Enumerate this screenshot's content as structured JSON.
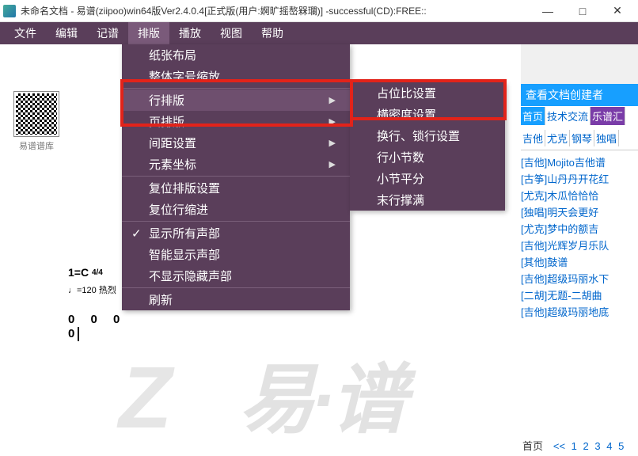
{
  "title": "未命名文档 - 易谱(ziipoo)win64版Ver2.4.0.4[正式版(用户:婀旷摇嶅槑瓓)] -successful(CD):FREE::",
  "menu": {
    "items": [
      "文件",
      "编辑",
      "记谱",
      "排版",
      "播放",
      "视图",
      "帮助"
    ],
    "active": 3
  },
  "dropdown": {
    "g1": [
      "纸张布局",
      "整体字号缩放"
    ],
    "g2": [
      {
        "label": "行排版",
        "arrow": true,
        "hover": true
      },
      {
        "label": "页排版",
        "arrow": true
      },
      {
        "label": "间距设置",
        "arrow": true
      },
      {
        "label": "元素坐标",
        "arrow": true
      }
    ],
    "g3": [
      "复位排版设置",
      "复位行缩进"
    ],
    "g4": [
      {
        "label": "显示所有声部",
        "check": true
      },
      {
        "label": "智能显示声部"
      },
      {
        "label": "不显示隐藏声部"
      }
    ],
    "g5": [
      "刷新"
    ]
  },
  "submenu": [
    "占位比设置",
    "横密度设置",
    "换行、锁行设置",
    "行小节数",
    "小节平分",
    "末行撑满"
  ],
  "qr_label": "易谱谱库",
  "score": {
    "key": "1=C",
    "time": "4/4",
    "tempo": "♩=120 热烈",
    "notes": "0 0 0 0"
  },
  "sidebar": {
    "view_author": "查看文档创建者",
    "tabs": [
      "首页",
      "技术交流",
      "乐谱汇"
    ],
    "cats": [
      "吉他",
      "尤克",
      "钢琴",
      "独唱"
    ],
    "songs": [
      "[吉他]Mojito吉他谱",
      "[古筝]山丹丹开花红",
      "[尤克]木瓜恰恰恰",
      "[独唱]明天会更好",
      "[尤克]梦中的额吉",
      "[吉他]光辉岁月乐队",
      "[其他]鼓谱",
      "[吉他]超级玛丽水下",
      "[二胡]无题-二胡曲",
      "[吉他]超级玛丽地底"
    ],
    "pager": {
      "home": "首页",
      "prev": "<<",
      "pages": [
        "1",
        "2",
        "3",
        "4",
        "5"
      ]
    }
  },
  "watermark": "易·谱",
  "wm_z": "Z"
}
